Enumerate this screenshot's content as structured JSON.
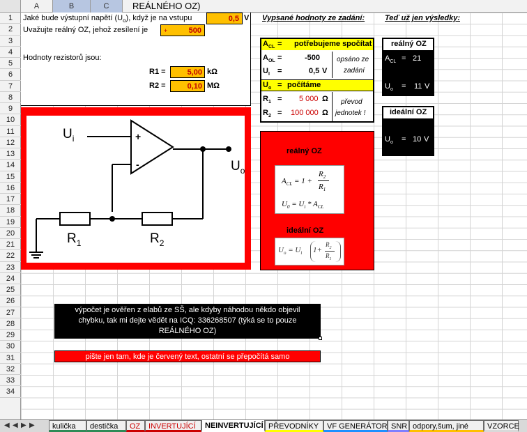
{
  "header": {
    "columns": [
      "A",
      "B",
      "C"
    ],
    "title_cell": "REÁLNÉHO  OZ)"
  },
  "rows": [
    "1",
    "2",
    "3",
    "4",
    "5",
    "6",
    "7",
    "8",
    "9",
    "10",
    "11",
    "12",
    "13",
    "14",
    "15",
    "16",
    "17",
    "18",
    "19",
    "20",
    "21",
    "22",
    "23",
    "24",
    "25",
    "26",
    "27",
    "28",
    "29",
    "30",
    "31",
    "32",
    "33",
    "34"
  ],
  "input": {
    "q1": "Jaké bude výstupní napětí (U",
    "q1_sub": "o",
    "q1_end": "), když je na vstupu",
    "ui_value": "0,5",
    "ui_unit": "V",
    "q2": "Uvažujte reálný OZ, jehož zesílení je",
    "gain_sign": "+",
    "gain_value": "500",
    "resist_title": "Hodnoty rezistorů jsou:",
    "r1_label": "R1 =",
    "r1_value": "5,00",
    "r1_unit": "kΩ",
    "r2_label": "R2 =",
    "r2_value": "0,10",
    "r2_unit": "MΩ"
  },
  "circuit": {
    "ui": "U",
    "ui_sub": "i",
    "uo": "U",
    "uo_sub": "o",
    "plus": "+",
    "minus": "-",
    "r1": "R",
    "r1_sub": "1",
    "r2": "R",
    "r2_sub": "2"
  },
  "given": {
    "title": "Vypsané hodnoty ze zadání:",
    "acl_label": "A",
    "acl_sub": "CL",
    "acl_eq": "=",
    "acl_text": "potřebujeme spočítat",
    "aol_label": "A",
    "aol_sub": "OL",
    "aol_eq": "=",
    "aol_value": "-500",
    "ui_label": "U",
    "ui_sub": "I",
    "ui_eq": "=",
    "ui_value": "0,5",
    "ui_unit": "V",
    "copy_note_1": "opsáno ze",
    "copy_note_2": "zadání",
    "uo_label": "U",
    "uo_sub": "o",
    "uo_eq": "=",
    "uo_text": "počítáme",
    "r1_label": "R",
    "r1_sub": "1",
    "r1_eq": "=",
    "r1_value": "5 000",
    "r1_unit": "Ω",
    "r2_label": "R",
    "r2_sub": "2",
    "r2_eq": "=",
    "r2_value": "100 000",
    "r2_unit": "Ω",
    "conv_note_1": "převod",
    "conv_note_2": "jednotek !"
  },
  "formulas": {
    "real_title": "reálný OZ",
    "real_f1_lhs": "A",
    "real_f1_sub": "CL",
    "real_f1_rhs": "= 1 +",
    "real_f1_num": "R",
    "real_f1_num_sub": "2",
    "real_f1_den": "R",
    "real_f1_den_sub": "1",
    "real_f2": "U",
    "real_f2_sub": "0",
    "real_f2_rhs": "= U",
    "real_f2_rhs_sub": "i",
    "real_f2_tail": "* A",
    "real_f2_tail_sub": "CL",
    "ideal_title": "ideální OZ",
    "ideal_lhs": "U",
    "ideal_lhs_sub": "o",
    "ideal_mid": "= U",
    "ideal_mid_sub": "i",
    "ideal_paren": "1+",
    "ideal_num": "R",
    "ideal_num_sub": "2",
    "ideal_den": "R",
    "ideal_den_sub": "1"
  },
  "results": {
    "title": "Teď už jen výsledky:",
    "real_title": "reálný OZ",
    "real_acl_label": "A",
    "real_acl_sub": "CL",
    "real_acl_eq": "=",
    "real_acl_value": "21",
    "real_uo_label": "U",
    "real_uo_sub": "o",
    "real_uo_eq": "=",
    "real_uo_value": "11",
    "real_uo_unit": "V",
    "ideal_title": "ideální OZ",
    "ideal_uo_label": "U",
    "ideal_uo_sub": "o",
    "ideal_uo_eq": "=",
    "ideal_uo_value": "10",
    "ideal_uo_unit": "V"
  },
  "notes": {
    "verify_line1": "výpočet je ověřen z elabů ze SŠ, ale kdyby náhodou někdo objevil",
    "verify_line2": "chybku, tak mi dejte vědět na ICQ: 336268507 (týká se to pouze",
    "verify_line3": "REÁLNÉHO  OZ)",
    "write_here": "pište jen tam, kde je červený text, ostatní se přepočítá samo"
  },
  "tabs": [
    {
      "label": "kulička",
      "color": "#2e8b57"
    },
    {
      "label": "destička",
      "color": "#2e8b57"
    },
    {
      "label": "OZ",
      "color": "#cc0000"
    },
    {
      "label": "INVERTUJÍCÍ",
      "color": "#cc0000"
    },
    {
      "label": "NEINVERTUJÍCÍ",
      "color": "#ffffff"
    },
    {
      "label": "PŘEVODNÍKY",
      "color": "#ffff00"
    },
    {
      "label": "VF GENERÁTOR",
      "color": "#1e90ff"
    },
    {
      "label": "SNR",
      "color": "#7f7fff"
    },
    {
      "label": "odpory,šum, jiné",
      "color": "#ffc000"
    },
    {
      "label": "VZORCE",
      "color": "#d9d9d9"
    }
  ],
  "nav": [
    "◀◀",
    "◀",
    "▶",
    "▶▶"
  ]
}
